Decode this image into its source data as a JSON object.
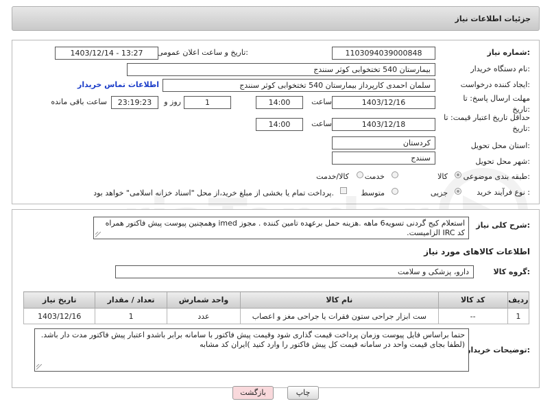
{
  "header": {
    "title": "جزئیات اطلاعات نیاز"
  },
  "fields": {
    "need_number_label": "شماره نیاز:",
    "need_number": "1103094039000848",
    "announce_label": "تاریخ و ساعت اعلان عمومی:",
    "announce_value": "1403/12/14 - 13:27",
    "buyer_label": "نام دستگاه خریدار:",
    "buyer_value": "بیمارستان 540 تختخوابی کوثر سنندج",
    "creator_label": "ایجاد کننده درخواست:",
    "creator_value": "سلمان احمدی کارپرداز بیمارستان 540 تختخوابی کوثر سنندج",
    "contact_link": "اطلاعات تماس خریدار",
    "deadline_label": "مهلت ارسال پاسخ: تا تاریخ:",
    "deadline_date": "1403/12/16",
    "time_word": "ساعت",
    "deadline_time": "14:00",
    "days_value": "1",
    "days_and": "روز و",
    "remaining_time": "23:19:23",
    "remaining_label": "ساعت باقی مانده",
    "validity_label": "حداقل تاریخ اعتبار قیمت: تا تاریخ:",
    "validity_date": "1403/12/18",
    "validity_time": "14:00",
    "province_label": "استان محل تحویل:",
    "province_value": "کردستان",
    "city_label": "شهر محل تحویل:",
    "city_value": "سنندج",
    "category_label": "طبقه بندی موضوعی:",
    "category_options": [
      "کالا",
      "خدمت",
      "کالا/خدمت"
    ],
    "category_selected": "کالا",
    "process_label": "نوع فرآیند خرید :",
    "process_options": [
      "جزیی",
      "متوسط"
    ],
    "process_selected": "جزیی",
    "payment_note": "پرداخت تمام یا بخشی از مبلغ خرید،از محل \"اسناد خزانه اسلامی\" خواهد بود."
  },
  "summary": {
    "label": "شرح کلی نیاز:",
    "text": "استعلام کیج گردنی تسویه6 ماهه .هزینه حمل برعهده تامین کننده . مجوز imed وهمچنین پیوست پیش فاکتور همراه کد IRC  الزامیست."
  },
  "items_section": {
    "title": "اطلاعات کالاهای مورد نیاز",
    "group_label": "گروه کالا:",
    "group_value": "دارو، پزشکی و سلامت"
  },
  "table": {
    "headers": [
      "ردیف",
      "کد کالا",
      "نام کالا",
      "واحد شمارش",
      "تعداد / مقدار",
      "تاریخ نیاز"
    ],
    "rows": [
      [
        "1",
        "--",
        "ست ابزار جراحی ستون فقرات یا جراحی مغز و اعصاب",
        "عدد",
        "1",
        "1403/12/16"
      ]
    ]
  },
  "buyer_notes": {
    "label": "توضیحات خریدار:",
    "text": "حتما براساس فایل پیوست  وزمان پرداخت قیمت گذاری شود وقیمت پیش فاکتور با سامانه برابر باشدو اعتبار پیش فاکتور مدت دار باشد.(لطفا بجای قیمت واحد در سامانه قیمت کل پیش فاکتور را وارد کنید )ایران کد مشابه"
  },
  "buttons": {
    "print": "چاپ",
    "back": "بازگشت"
  },
  "colors": {
    "link": "#1a3cc8",
    "back_button_bg": "#f9d9dc"
  }
}
